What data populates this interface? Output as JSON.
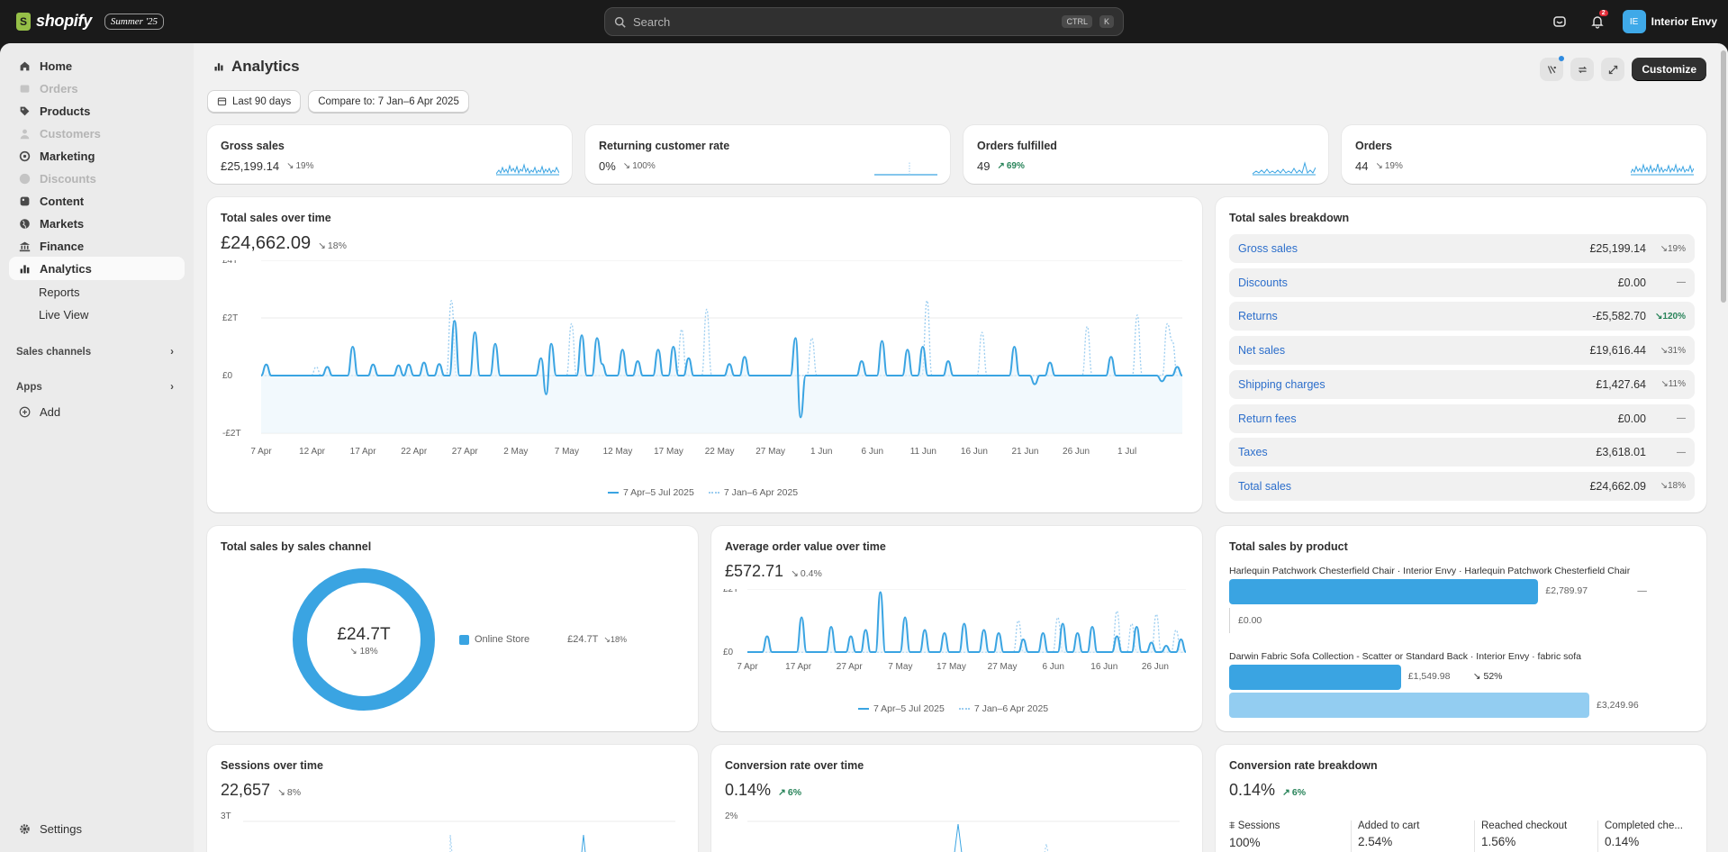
{
  "topbar": {
    "logo_text": "shopify",
    "edition_badge": "Summer '25",
    "search_placeholder": "Search",
    "kbd_ctrl": "CTRL",
    "kbd_k": "K",
    "notification_count": "2",
    "store_initials": "IE",
    "store_name": "Interior Envy"
  },
  "sidebar": {
    "items": [
      {
        "label": "Home",
        "icon": "home-icon"
      },
      {
        "label": "Orders",
        "icon": "orders-icon"
      },
      {
        "label": "Products",
        "icon": "tag-icon"
      },
      {
        "label": "Customers",
        "icon": "person-icon"
      },
      {
        "label": "Marketing",
        "icon": "target-icon"
      },
      {
        "label": "Discounts",
        "icon": "discount-icon"
      },
      {
        "label": "Content",
        "icon": "content-icon"
      },
      {
        "label": "Markets",
        "icon": "globe-icon"
      },
      {
        "label": "Finance",
        "icon": "bank-icon"
      },
      {
        "label": "Analytics",
        "icon": "chart-icon"
      }
    ],
    "sub_items": [
      {
        "label": "Reports"
      },
      {
        "label": "Live View"
      }
    ],
    "sales_channels": "Sales channels",
    "apps": "Apps",
    "add": "Add",
    "settings": "Settings"
  },
  "page": {
    "title": "Analytics",
    "date_range": "Last 90 days",
    "compare": "Compare to: 7 Jan–6 Apr 2025",
    "customize": "Customize"
  },
  "kpis": [
    {
      "title": "Gross sales",
      "value": "£25,199.14",
      "change": "19%",
      "dir": "down"
    },
    {
      "title": "Returning customer rate",
      "value": "0%",
      "change": "100%",
      "dir": "down"
    },
    {
      "title": "Orders fulfilled",
      "value": "49",
      "change": "69%",
      "dir": "up"
    },
    {
      "title": "Orders",
      "value": "44",
      "change": "19%",
      "dir": "down"
    }
  ],
  "total_sales": {
    "title": "Total sales over time",
    "value": "£24,662.09",
    "change": "18%",
    "chart_data": {
      "type": "line",
      "yticks": [
        "£4T",
        "£2T",
        "£0",
        "-£2T"
      ],
      "ylim": [
        -2000,
        4000
      ],
      "xticks": [
        "7 Apr",
        "12 Apr",
        "17 Apr",
        "22 Apr",
        "27 Apr",
        "2 May",
        "7 May",
        "12 May",
        "17 May",
        "22 May",
        "27 May",
        "1 Jun",
        "6 Jun",
        "11 Jun",
        "16 Jun",
        "21 Jun",
        "26 Jun",
        "1 Jul"
      ],
      "series": [
        {
          "name": "7 Apr–5 Jul 2025",
          "values": [
            0,
            380,
            0,
            0,
            0,
            0,
            0,
            0,
            0,
            0,
            0,
            0,
            0,
            300,
            0,
            0,
            0,
            0,
            1000,
            0,
            0,
            0,
            380,
            0,
            0,
            0,
            0,
            350,
            0,
            380,
            0,
            0,
            450,
            0,
            0,
            400,
            0,
            0,
            1900,
            0,
            0,
            0,
            1500,
            0,
            0,
            0,
            1100,
            0,
            0,
            0,
            0,
            0,
            0,
            0,
            0,
            600,
            -650,
            1100,
            0,
            0,
            0,
            0,
            0,
            1400,
            0,
            0,
            1300,
            400,
            0,
            0,
            0,
            900,
            0,
            0,
            500,
            0,
            0,
            0,
            900,
            0,
            0,
            1000,
            0,
            0,
            600,
            0,
            0,
            0,
            0,
            0,
            0,
            0,
            400,
            0,
            0,
            650,
            0,
            0,
            0,
            0,
            0,
            0,
            0,
            0,
            0,
            1300,
            -1450,
            0,
            0,
            0,
            0,
            0,
            0,
            0,
            0,
            0,
            0,
            0,
            500,
            0,
            0,
            0,
            1200,
            0,
            0,
            0,
            0,
            900,
            0,
            0,
            1000,
            0,
            0,
            0,
            0,
            500,
            0,
            0,
            0,
            0,
            0,
            0,
            0,
            0,
            0,
            0,
            0,
            0,
            1000,
            0,
            0,
            0,
            -300,
            0,
            0,
            450,
            0,
            0,
            0,
            0,
            0,
            0,
            0,
            0,
            0,
            0,
            0,
            650,
            0,
            0,
            0,
            0,
            0,
            0,
            0,
            0,
            0,
            -200,
            0,
            0,
            300,
            0
          ]
        },
        {
          "name": "7 Jan–6 Apr 2025",
          "values": [
            0,
            0,
            0,
            0,
            0,
            0,
            0,
            0,
            0,
            0,
            0,
            300,
            0,
            0,
            0,
            0,
            0,
            0,
            0,
            0,
            0,
            0,
            0,
            0,
            0,
            0,
            0,
            0,
            0,
            0,
            0,
            0,
            0,
            0,
            0,
            0,
            0,
            0,
            2600,
            0,
            0,
            0,
            0,
            0,
            0,
            0,
            0,
            0,
            0,
            0,
            0,
            0,
            0,
            0,
            0,
            0,
            0,
            0,
            0,
            0,
            0,
            0,
            1800,
            0,
            0,
            0,
            0,
            0,
            0,
            0,
            0,
            0,
            0,
            0,
            0,
            0,
            0,
            0,
            0,
            0,
            0,
            0,
            0,
            0,
            1600,
            0,
            0,
            0,
            0,
            2300,
            0,
            0,
            0,
            0,
            0,
            0,
            0,
            0,
            0,
            0,
            0,
            0,
            0,
            0,
            0,
            0,
            0,
            0,
            0,
            0,
            1300,
            0,
            0,
            0,
            0,
            0,
            0,
            0,
            0,
            0,
            0,
            0,
            0,
            0,
            0,
            0,
            0,
            0,
            0,
            0,
            0,
            0,
            0,
            2600,
            0,
            0,
            0,
            0,
            0,
            0,
            0,
            0,
            0,
            0,
            1500,
            0,
            0,
            0,
            0,
            0,
            0,
            0,
            0,
            0,
            0,
            0,
            0,
            0,
            0,
            0,
            0,
            0,
            0,
            0,
            0,
            1700,
            0,
            0,
            0,
            0,
            0,
            0,
            0,
            0,
            0,
            2100,
            0,
            0,
            0,
            0,
            0,
            1800,
            1200,
            0,
            0
          ]
        }
      ]
    }
  },
  "breakdown": {
    "title": "Total sales breakdown",
    "rows": [
      {
        "name": "Gross sales",
        "value": "£25,199.14",
        "change": "19%",
        "dir": "down"
      },
      {
        "name": "Discounts",
        "value": "£0.00",
        "change": "—",
        "dir": "none"
      },
      {
        "name": "Returns",
        "value": "-£5,582.70",
        "change": "120%",
        "dir": "up"
      },
      {
        "name": "Net sales",
        "value": "£19,616.44",
        "change": "31%",
        "dir": "down"
      },
      {
        "name": "Shipping charges",
        "value": "£1,427.64",
        "change": "11%",
        "dir": "down"
      },
      {
        "name": "Return fees",
        "value": "£0.00",
        "change": "—",
        "dir": "none"
      },
      {
        "name": "Taxes",
        "value": "£3,618.01",
        "change": "—",
        "dir": "none"
      },
      {
        "name": "Total sales",
        "value": "£24,662.09",
        "change": "18%",
        "dir": "down"
      }
    ]
  },
  "by_channel": {
    "title": "Total sales by sales channel",
    "center_value": "£24.7T",
    "center_change": "18%",
    "legend_name": "Online Store",
    "legend_value": "£24.7T",
    "legend_change": "18%",
    "chart_data": {
      "type": "pie",
      "categories": [
        "Online Store"
      ],
      "values": [
        24.7
      ]
    }
  },
  "aov": {
    "title": "Average order value over time",
    "value": "£572.71",
    "change": "0.4%",
    "chart_data": {
      "type": "line",
      "yticks": [
        "£2T",
        "£0"
      ],
      "ylim": [
        0,
        2000
      ],
      "xticks": [
        "7 Apr",
        "17 Apr",
        "27 Apr",
        "7 May",
        "17 May",
        "27 May",
        "6 Jun",
        "16 Jun",
        "26 Jun"
      ],
      "series": [
        {
          "name": "7 Apr–5 Jul 2025",
          "values": [
            0,
            0,
            0,
            0,
            500,
            0,
            0,
            0,
            0,
            0,
            0,
            1100,
            0,
            0,
            0,
            0,
            0,
            800,
            0,
            0,
            0,
            500,
            0,
            0,
            700,
            0,
            0,
            1900,
            0,
            0,
            0,
            0,
            1100,
            0,
            0,
            0,
            700,
            0,
            0,
            0,
            600,
            0,
            0,
            0,
            900,
            0,
            0,
            0,
            700,
            0,
            0,
            600,
            0,
            0,
            0,
            0,
            400,
            0,
            0,
            0,
            600,
            0,
            0,
            0,
            900,
            0,
            0,
            600,
            0,
            0,
            800,
            0,
            0,
            0,
            0,
            500,
            0,
            0,
            0,
            800,
            0,
            0,
            300,
            0,
            0,
            200,
            0,
            0,
            400,
            0
          ]
        },
        {
          "name": "7 Jan–6 Apr 2025",
          "values": [
            0,
            0,
            0,
            0,
            0,
            0,
            0,
            0,
            0,
            0,
            0,
            0,
            0,
            0,
            0,
            0,
            0,
            0,
            0,
            0,
            0,
            0,
            0,
            0,
            0,
            0,
            0,
            0,
            0,
            0,
            0,
            0,
            0,
            0,
            0,
            0,
            0,
            0,
            0,
            0,
            0,
            0,
            0,
            0,
            0,
            0,
            0,
            0,
            0,
            0,
            0,
            0,
            0,
            0,
            0,
            1000,
            0,
            0,
            0,
            0,
            0,
            0,
            0,
            1100,
            0,
            0,
            0,
            0,
            0,
            0,
            0,
            0,
            0,
            0,
            0,
            1300,
            0,
            0,
            900,
            0,
            0,
            0,
            0,
            1200,
            0,
            0,
            0,
            700,
            0,
            0
          ]
        }
      ]
    }
  },
  "by_product": {
    "title": "Total sales by product",
    "products": [
      {
        "label": "Harlequin Patchwork Chesterfield Chair · Interior Envy · Harlequin Patchwork Chesterfield Chair",
        "current": "£2,789.97",
        "current_value": 2789.97,
        "change": "—",
        "previous": "£0.00",
        "previous_value": 0
      },
      {
        "label": "Darwin Fabric Sofa Collection - Scatter or Standard Back · Interior Envy · fabric sofa",
        "current": "£1,549.98",
        "current_value": 1549.98,
        "change": "52%",
        "previous": "£3,249.96",
        "previous_value": 3249.96
      }
    ]
  },
  "sessions": {
    "title": "Sessions over time",
    "value": "22,657",
    "change": "8%",
    "ytick": "3T"
  },
  "conversion": {
    "title": "Conversion rate over time",
    "value": "0.14%",
    "change": "6%",
    "ytick": "2%"
  },
  "conv_breakdown": {
    "title": "Conversion rate breakdown",
    "value": "0.14%",
    "change": "6%",
    "stats": [
      {
        "label": "Sessions",
        "value": "100%"
      },
      {
        "label": "Added to cart",
        "value": "2.54%"
      },
      {
        "label": "Reached checkout",
        "value": "1.56%"
      },
      {
        "label": "Completed che...",
        "value": "0.14%"
      }
    ]
  },
  "colors": {
    "accent": "#3aa4e2",
    "compare": "#9bcdf0",
    "up": "#29845a"
  }
}
